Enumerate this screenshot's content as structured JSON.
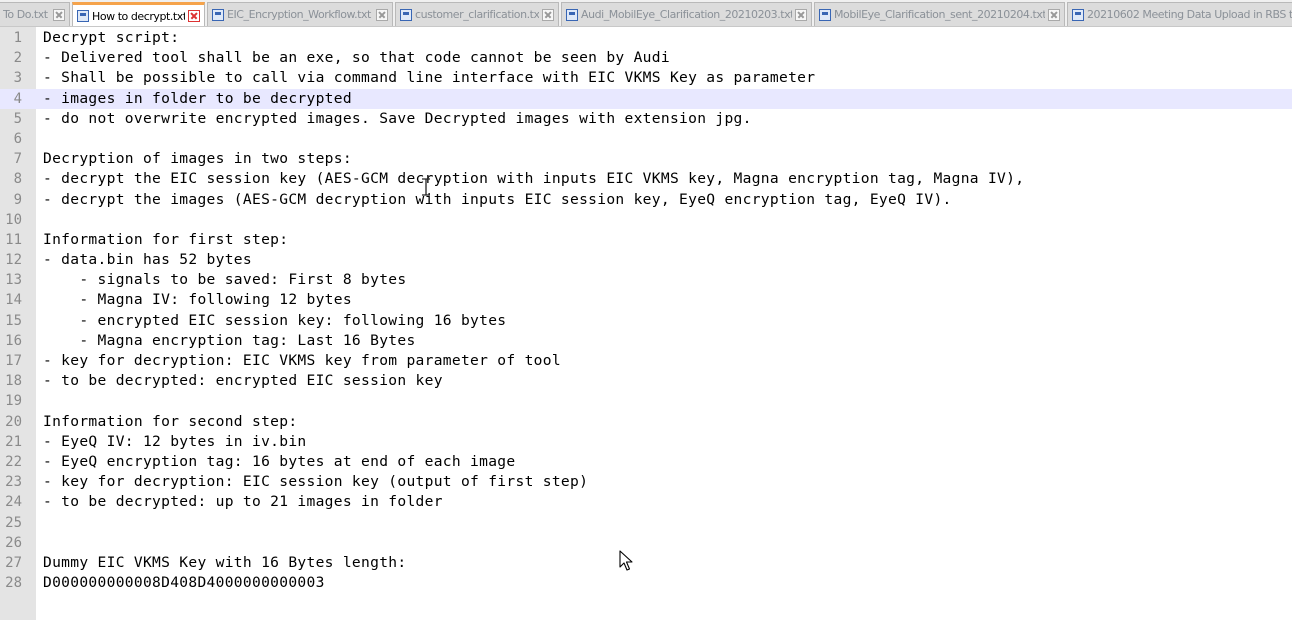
{
  "tabs": [
    {
      "label": "To Do.txt"
    },
    {
      "label": "How to decrypt.txt"
    },
    {
      "label": "EIC_Encryption_Workflow.txt"
    },
    {
      "label": "customer_clarification.txt"
    },
    {
      "label": "Audi_MobilEye_Clarification_20210203.txt"
    },
    {
      "label": "MobilEye_Clarification_sent_20210204.txt"
    },
    {
      "label": "20210602 Meeting Data Upload in RBS t"
    }
  ],
  "active_tab": "How to decrypt.txt",
  "editor": {
    "current_line": 4,
    "lines": [
      {
        "n": "1",
        "text": "Decrypt script:"
      },
      {
        "n": "2",
        "text": "- Delivered tool shall be an exe, so that code cannot be seen by Audi"
      },
      {
        "n": "3",
        "text": "- Shall be possible to call via command line interface with EIC VKMS Key as parameter"
      },
      {
        "n": "4",
        "text": "- images in folder to be decrypted"
      },
      {
        "n": "5",
        "text": "- do not overwrite encrypted images. Save Decrypted images with extension jpg."
      },
      {
        "n": "6",
        "text": ""
      },
      {
        "n": "7",
        "text": "Decryption of images in two steps:"
      },
      {
        "n": "8",
        "text": "- decrypt the EIC session key (AES-GCM decryption with inputs EIC VKMS key, Magna encryption tag, Magna IV),"
      },
      {
        "n": "9",
        "text": "- decrypt the images (AES-GCM decryption with inputs EIC session key, EyeQ encryption tag, EyeQ IV)."
      },
      {
        "n": "10",
        "text": ""
      },
      {
        "n": "11",
        "text": "Information for first step:"
      },
      {
        "n": "12",
        "text": "- data.bin has 52 bytes"
      },
      {
        "n": "13",
        "text": "    - signals to be saved: First 8 bytes"
      },
      {
        "n": "14",
        "text": "    - Magna IV: following 12 bytes"
      },
      {
        "n": "15",
        "text": "    - encrypted EIC session key: following 16 bytes"
      },
      {
        "n": "16",
        "text": "    - Magna encryption tag: Last 16 Bytes"
      },
      {
        "n": "17",
        "text": "- key for decryption: EIC VKMS key from parameter of tool"
      },
      {
        "n": "18",
        "text": "- to be decrypted: encrypted EIC session key"
      },
      {
        "n": "19",
        "text": ""
      },
      {
        "n": "20",
        "text": "Information for second step:"
      },
      {
        "n": "21",
        "text": "- EyeQ IV: 12 bytes in iv.bin"
      },
      {
        "n": "22",
        "text": "- EyeQ encryption tag: 16 bytes at end of each image"
      },
      {
        "n": "23",
        "text": "- key for decryption: EIC session key (output of first step)"
      },
      {
        "n": "24",
        "text": "- to be decrypted: up to 21 images in folder"
      },
      {
        "n": "25",
        "text": ""
      },
      {
        "n": "26",
        "text": ""
      },
      {
        "n": "27",
        "text": "Dummy EIC VKMS Key with 16 Bytes length:"
      },
      {
        "n": "28",
        "text": "D000000000008D408D4000000000003"
      }
    ]
  },
  "icons": {
    "tab_file": "document-icon",
    "tab_close": "close-icon",
    "text_cursor": "ibeam-cursor-icon",
    "mouse_cursor": "arrow-cursor-icon"
  },
  "colors": {
    "active_tab_accent": "#f5a34b",
    "current_line_highlight": "#e8e8ff",
    "gutter": "#e4e4e4",
    "close_active": "#dd3333"
  }
}
